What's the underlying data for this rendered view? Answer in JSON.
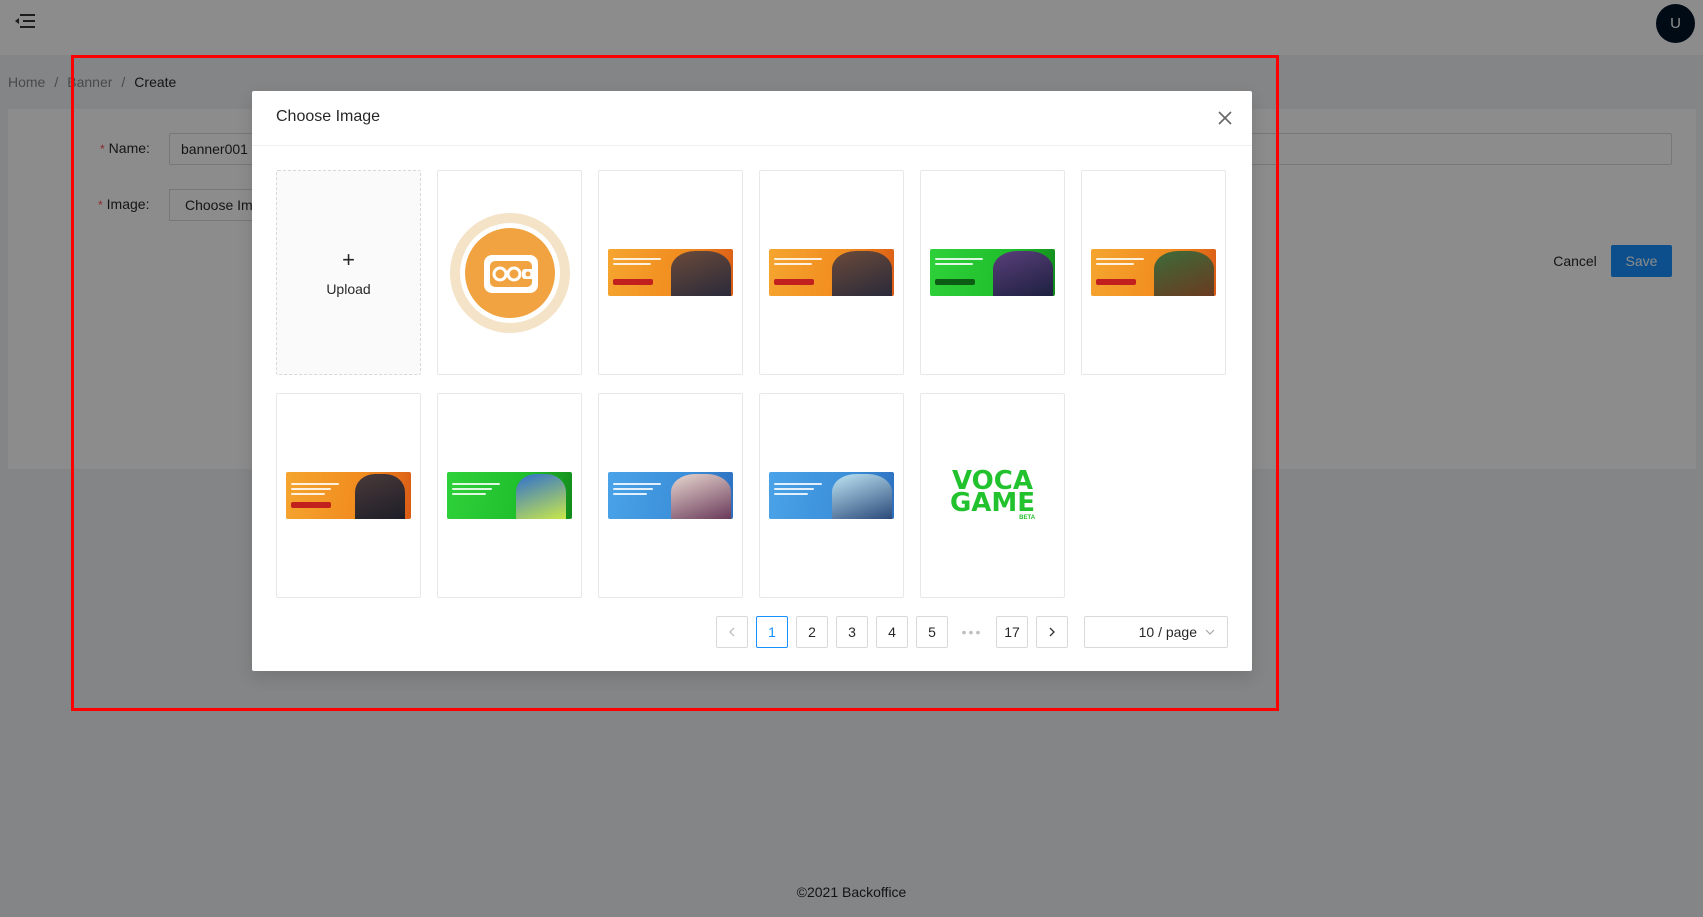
{
  "header": {
    "avatar_initial": "U",
    "menu_icon": "menu-fold-icon"
  },
  "breadcrumb": {
    "items": [
      "Home",
      "Banner",
      "Create"
    ],
    "separator": "/"
  },
  "form": {
    "name_label": "Name",
    "name_value": "banner001",
    "image_label": "Image",
    "choose_image_label": "Choose Image",
    "required_mark": "*"
  },
  "actions": {
    "cancel": "Cancel",
    "save": "Save"
  },
  "footer": {
    "text": "©2021 Backoffice"
  },
  "modal": {
    "title": "Choose Image",
    "upload_label": "Upload",
    "images": [
      {
        "name": "wallet-logo"
      },
      {
        "name": "orange-banner",
        "color": "orange"
      },
      {
        "name": "orange-banner",
        "color": "orange"
      },
      {
        "name": "green-banner",
        "color": "green"
      },
      {
        "name": "orange-banner",
        "color": "orange"
      },
      {
        "name": "orange-banner",
        "color": "orange"
      },
      {
        "name": "green-banner",
        "color": "green"
      },
      {
        "name": "blue-banner",
        "color": "blue"
      },
      {
        "name": "blue-banner",
        "color": "blue"
      },
      {
        "name": "voca-game-logo",
        "line1": "VOCA",
        "line2": "GAME",
        "badge": "BETA"
      }
    ],
    "pagination": {
      "pages": [
        "1",
        "2",
        "3",
        "4",
        "5"
      ],
      "current": 1,
      "ellipsis": "•••",
      "last": "17",
      "page_size": "10 / page"
    }
  },
  "colors": {
    "primary": "#1890ff",
    "required": "#ff4d4f",
    "highlight": "#ff0000",
    "avatar_bg": "#001529"
  }
}
